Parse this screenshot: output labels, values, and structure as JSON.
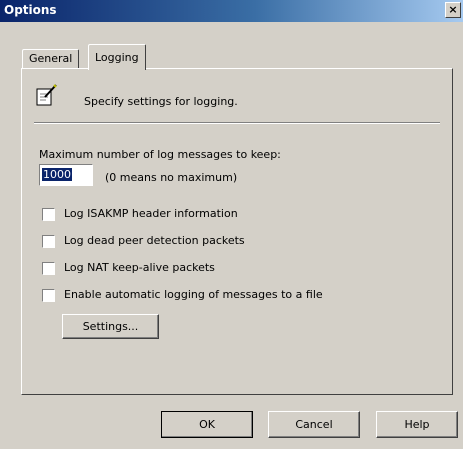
{
  "window": {
    "title": "Options",
    "close_glyph": "×"
  },
  "tabs": [
    {
      "label": "General",
      "active": false
    },
    {
      "label": "Logging",
      "active": true
    }
  ],
  "header": {
    "icon": "notepad-pencil-icon",
    "text": "Specify settings for logging."
  },
  "max_messages": {
    "label": "Maximum number of log messages to keep:",
    "value": "1000",
    "hint": "(0 means no maximum)"
  },
  "checkboxes": [
    {
      "label": "Log ISAKMP header information",
      "checked": false
    },
    {
      "label": "Log dead peer detection packets",
      "checked": false
    },
    {
      "label": "Log NAT keep-alive packets",
      "checked": false
    },
    {
      "label": "Enable automatic logging of messages to a file",
      "checked": false
    }
  ],
  "settings_button": "Settings...",
  "footer": {
    "ok": "OK",
    "cancel": "Cancel",
    "help": "Help"
  }
}
